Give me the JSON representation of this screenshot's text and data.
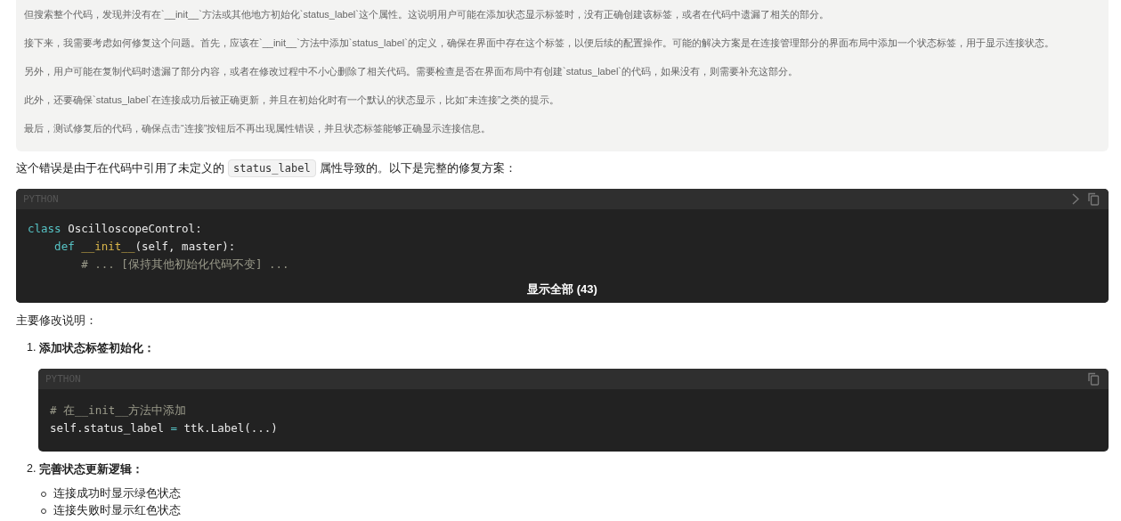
{
  "thinking": {
    "paragraphs": [
      "但搜索整个代码，发现并没有在`__init__`方法或其他地方初始化`status_label`这个属性。这说明用户可能在添加状态显示标签时，没有正确创建该标签，或者在代码中遗漏了相关的部分。",
      "接下来，我需要考虑如何修复这个问题。首先，应该在`__init__`方法中添加`status_label`的定义，确保在界面中存在这个标签，以便后续的配置操作。可能的解决方案是在连接管理部分的界面布局中添加一个状态标签，用于显示连接状态。",
      "另外，用户可能在复制代码时遗漏了部分内容，或者在修改过程中不小心删除了相关代码。需要检查是否在界面布局中有创建`status_label`的代码，如果没有，则需要补充这部分。",
      "此外，还要确保`status_label`在连接成功后被正确更新，并且在初始化时有一个默认的状态显示，比如“未连接”之类的提示。",
      "最后，测试修复后的代码，确保点击“连接”按钮后不再出现属性错误，并且状态标签能够正确显示连接信息。"
    ]
  },
  "intro": {
    "before": "这个错误是由于在代码中引用了未定义的",
    "code": "status_label",
    "after": "属性导致的。以下是完整的修复方案："
  },
  "main_code": {
    "language": "PYTHON",
    "collapsed": true,
    "expand_label": "显示全部 (43)",
    "lines": [
      {
        "tokens": [
          {
            "text": "class ",
            "kind": "keyword"
          },
          {
            "text": "OscilloscopeControl:",
            "kind": "plain"
          }
        ]
      },
      {
        "tokens": [
          {
            "text": "    def ",
            "kind": "keyword"
          },
          {
            "text": "__init__",
            "kind": "function"
          },
          {
            "text": "(self, master):",
            "kind": "plain"
          }
        ]
      },
      {
        "tokens": [
          {
            "text": "        # ... [保持其他初始化代码不变] ...",
            "kind": "comment"
          }
        ]
      }
    ]
  },
  "summary_heading": "主要修改说明：",
  "steps": [
    {
      "number": "1.",
      "title": "添加状态标签初始化：",
      "code": {
        "language": "PYTHON",
        "lines": [
          {
            "tokens": [
              {
                "text": "# 在__init__方法中添加",
                "kind": "comment"
              }
            ]
          },
          {
            "tokens": [
              {
                "text": "self.status_label ",
                "kind": "plain"
              },
              {
                "text": "=",
                "kind": "operator"
              },
              {
                "text": " ttk.Label(...)",
                "kind": "plain"
              }
            ]
          }
        ]
      }
    },
    {
      "number": "2.",
      "title": "完善状态更新逻辑：",
      "bullets": [
        "连接成功时显示绿色状态",
        "连接失败时显示红色状态"
      ]
    }
  ]
}
